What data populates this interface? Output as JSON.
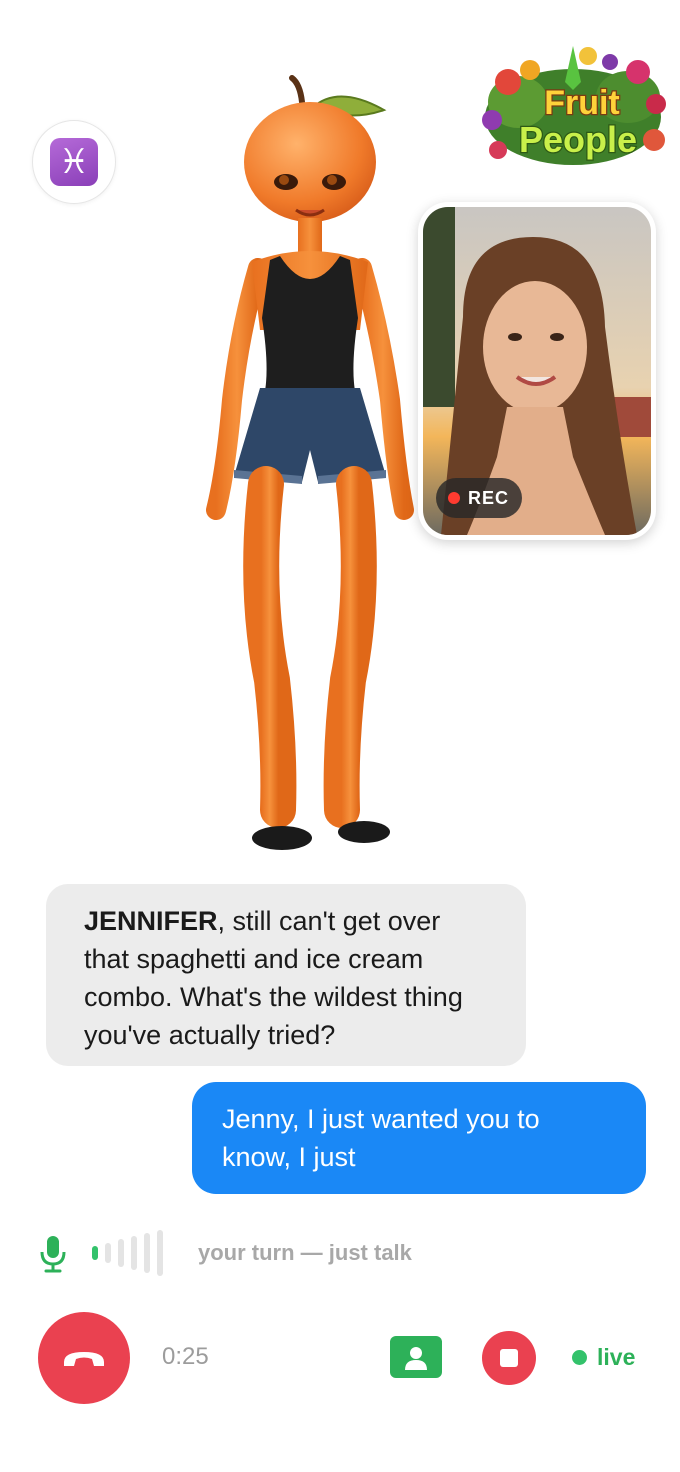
{
  "zodiac": {
    "symbol": "♓",
    "icon": "pisces-icon"
  },
  "logo": {
    "line1": "Fruit",
    "line2": "People"
  },
  "camera": {
    "rec_label": "REC"
  },
  "messages": [
    {
      "from": "ai",
      "name": "JENNIFER",
      "text": ", still can't get over that spaghetti and ice cream combo. What's the wildest thing you've actually tried?"
    },
    {
      "from": "user",
      "text": "Jenny, I just wanted you to know, I just"
    }
  ],
  "turn": {
    "label": "your turn — just talk",
    "mic_icon": "microphone-icon",
    "level": 0.1
  },
  "controls": {
    "timer": "0:25",
    "hangup_icon": "phone-hangup-icon",
    "contact_icon": "contact-card-icon",
    "stop_icon": "stop-recording-icon",
    "live_label": "live"
  },
  "colors": {
    "accent_blue": "#1a88f6",
    "danger_red": "#ea4150",
    "live_green": "#2db159",
    "bubble_gray": "#ececec"
  }
}
